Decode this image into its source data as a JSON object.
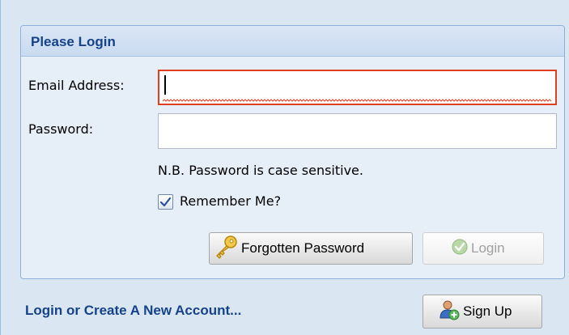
{
  "form": {
    "title": "Please Login",
    "email_label": "Email Address:",
    "email_value": "",
    "password_label": "Password:",
    "password_value": "",
    "note": "N.B. Password is case sensitive.",
    "remember_label": "Remember Me?",
    "remember_checked": true,
    "forgot_label": "Forgotten Password",
    "login_label": "Login"
  },
  "footer": {
    "link_text": "Login or Create A New Account...",
    "signup_label": "Sign Up"
  },
  "icons": {
    "forgot": "key-icon",
    "login": "check-circle-icon",
    "signup": "add-user-icon",
    "checkbox": "checkmark-icon"
  },
  "colors": {
    "title": "#15428b",
    "invalid_border": "#e04020",
    "panel_bg": "#dbe6f3"
  }
}
